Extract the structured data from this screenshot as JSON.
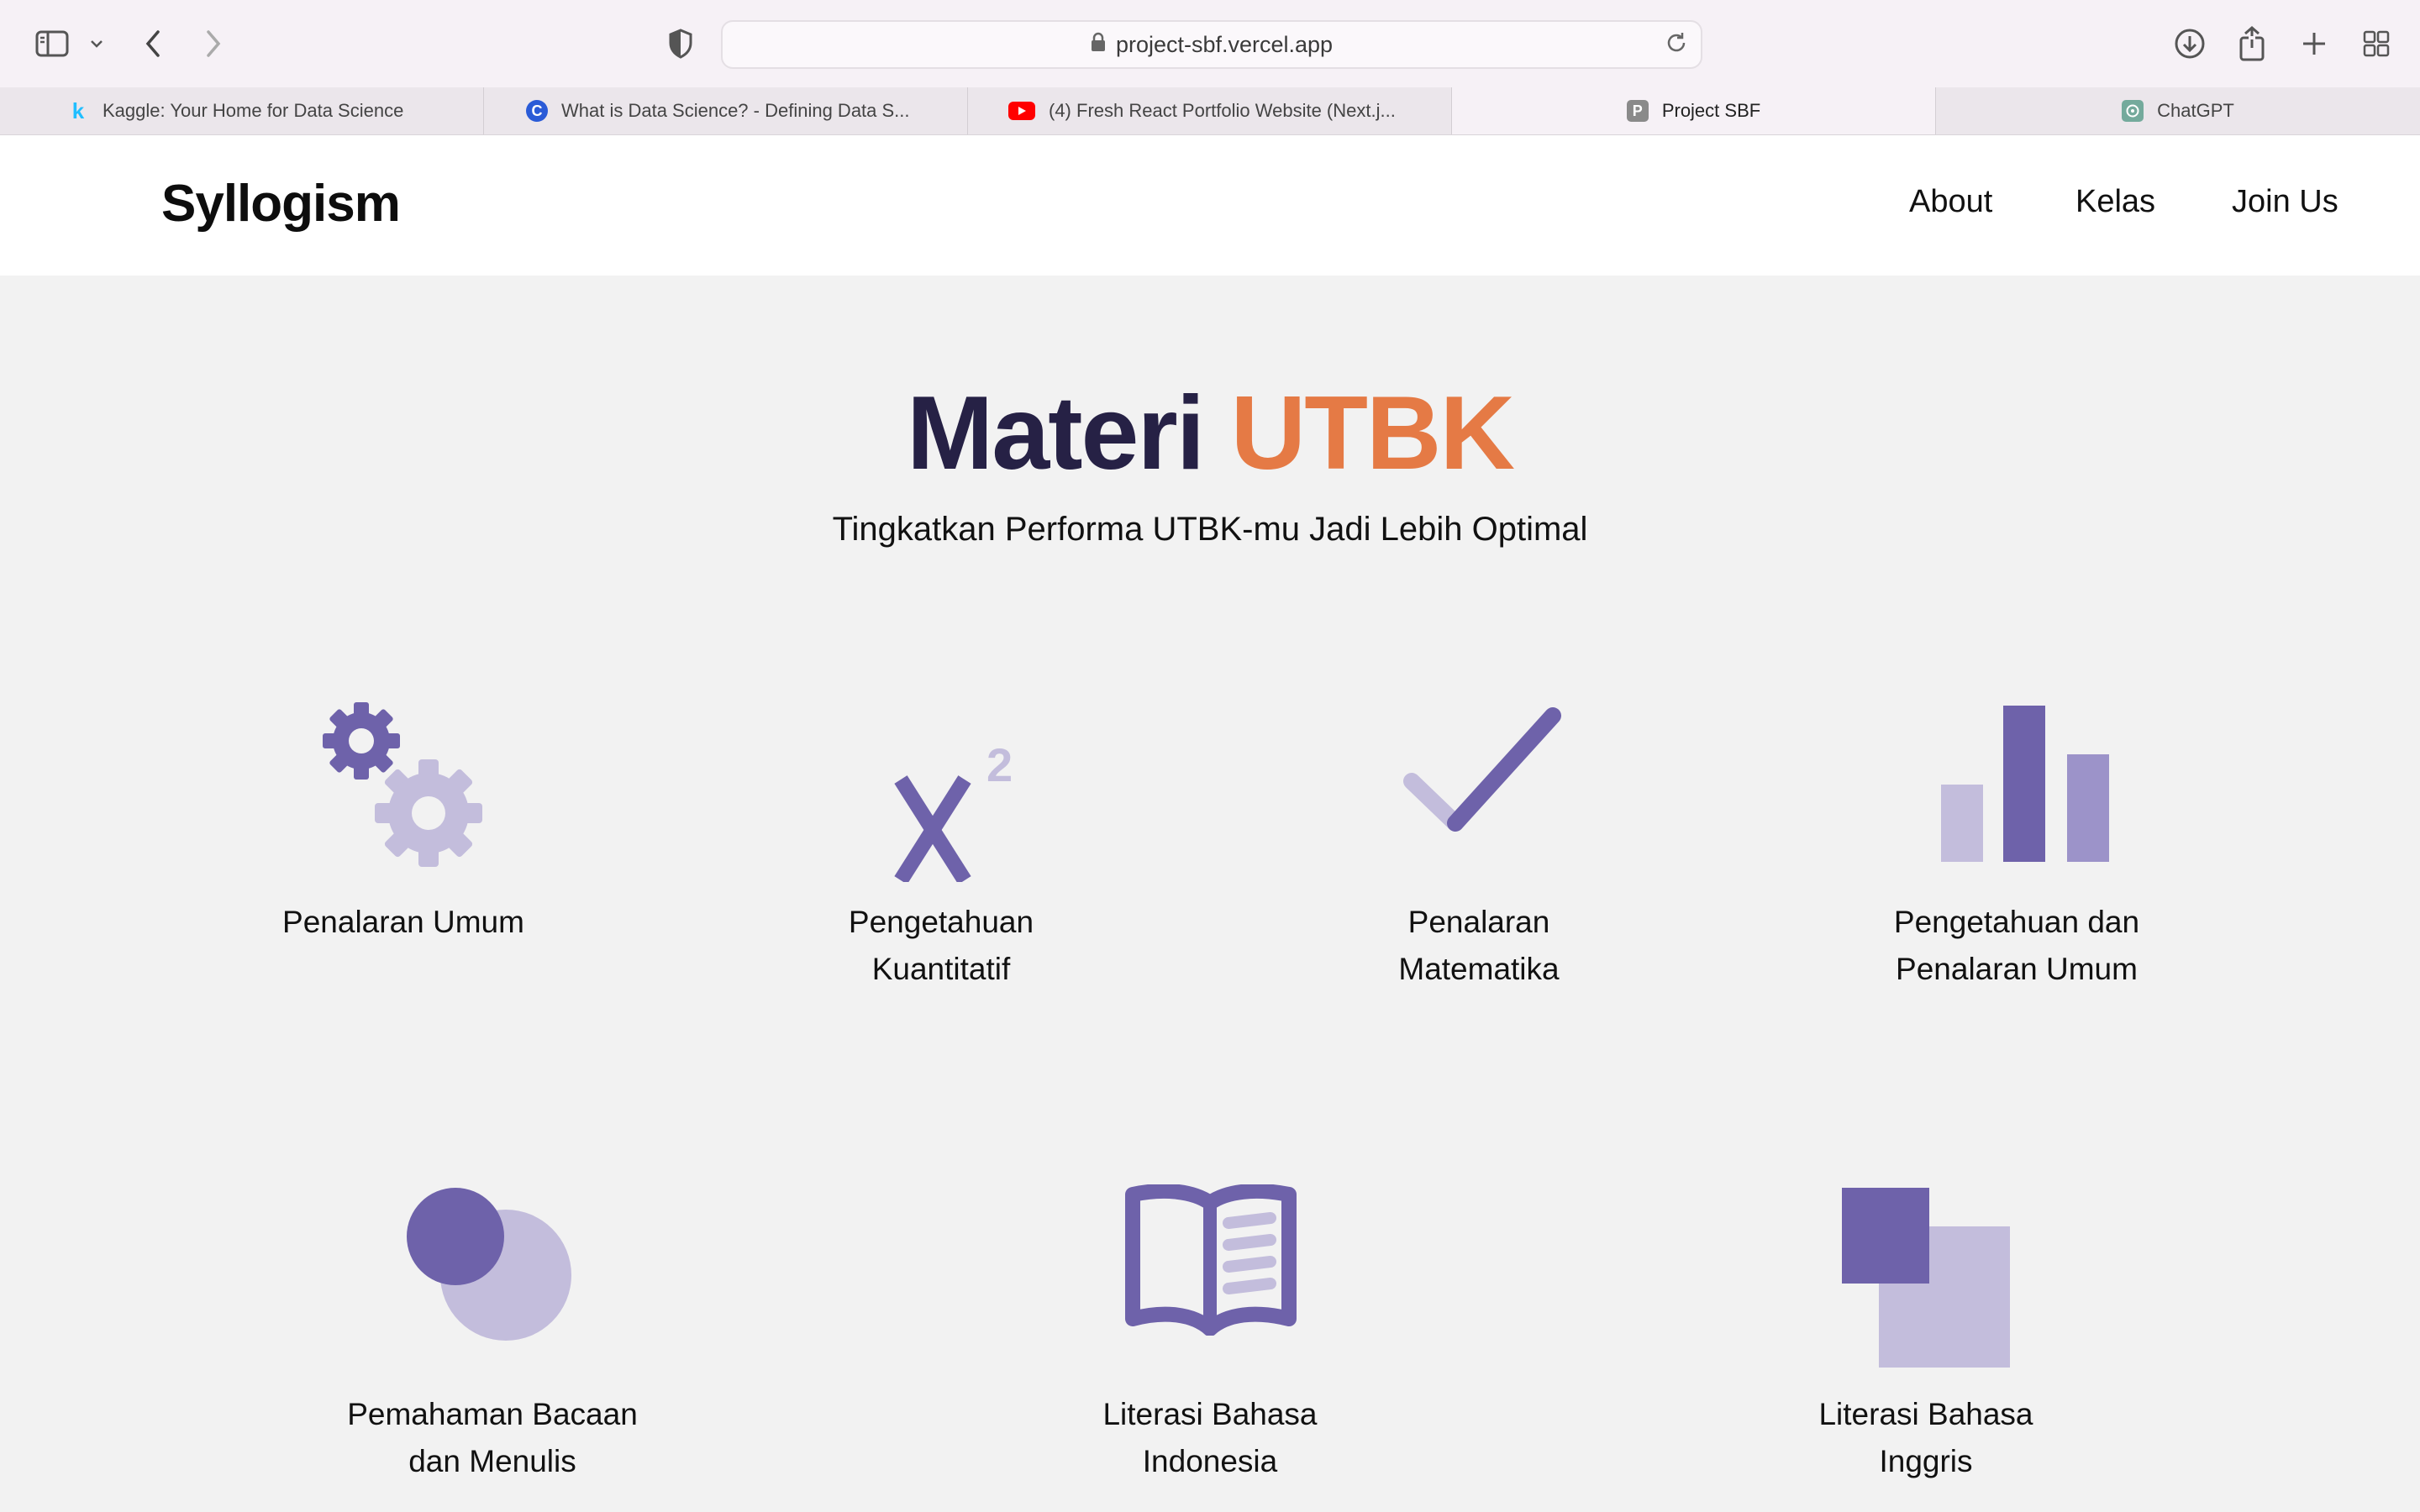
{
  "browser": {
    "url": "project-sbf.vercel.app",
    "tabs": [
      {
        "title": "Kaggle: Your Home for Data Science",
        "favicon": "kaggle-k"
      },
      {
        "title": "What is Data Science? - Defining Data S...",
        "favicon": "coursera-c"
      },
      {
        "title": "(4) Fresh React Portfolio Website (Next.j...",
        "favicon": "youtube-play"
      },
      {
        "title": "Project SBF",
        "favicon": "project-p"
      },
      {
        "title": "ChatGPT",
        "favicon": "chatgpt-logo"
      }
    ],
    "active_tab": 3
  },
  "site": {
    "brand": "Syllogism",
    "nav": [
      "About",
      "Kelas",
      "Join Us"
    ]
  },
  "hero": {
    "title_part1": "Materi",
    "title_part2": "UTBK",
    "subtitle": "Tingkatkan Performa UTBK-mu Jadi Lebih Optimal"
  },
  "cards": [
    {
      "line1": "Penalaran Umum",
      "line2": "",
      "icon": "gears-icon"
    },
    {
      "line1": "Pengetahuan",
      "line2": "Kuantitatif",
      "icon": "x-squared-icon"
    },
    {
      "line1": "Penalaran",
      "line2": "Matematika",
      "icon": "checkmark-icon"
    },
    {
      "line1": "Pengetahuan dan",
      "line2": "Penalaran Umum",
      "icon": "bar-chart-icon"
    },
    {
      "line1": "Pemahaman Bacaan",
      "line2": "dan Menulis",
      "icon": "circles-icon"
    },
    {
      "line1": "Literasi Bahasa",
      "line2": "Indonesia",
      "icon": "book-icon"
    },
    {
      "line1": "Literasi Bahasa",
      "line2": "Inggris",
      "icon": "squares-icon"
    }
  ],
  "colors": {
    "accent_orange": "#e57a45",
    "title_navy": "#262145",
    "icon_purple": "#6e62aa",
    "icon_light_purple": "#c3bddc"
  }
}
